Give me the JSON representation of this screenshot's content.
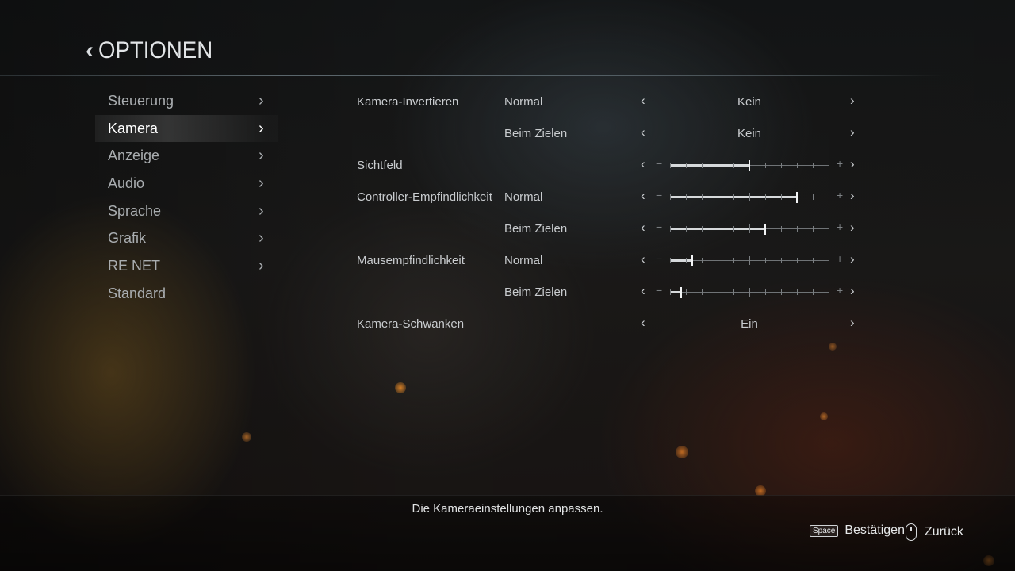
{
  "header": {
    "back_icon": "chevron-left-icon",
    "title": "OPTIONEN"
  },
  "menu": {
    "items": [
      {
        "label": "Steuerung",
        "has_arrow": true,
        "active": false
      },
      {
        "label": "Kamera",
        "has_arrow": true,
        "active": true
      },
      {
        "label": "Anzeige",
        "has_arrow": true,
        "active": false
      },
      {
        "label": "Audio",
        "has_arrow": true,
        "active": false
      },
      {
        "label": "Sprache",
        "has_arrow": true,
        "active": false
      },
      {
        "label": "Grafik",
        "has_arrow": true,
        "active": false
      },
      {
        "label": "RE NET",
        "has_arrow": true,
        "active": false
      },
      {
        "label": "Standard",
        "has_arrow": false,
        "active": false
      }
    ]
  },
  "settings": {
    "rows": [
      {
        "label": "Kamera-Invertieren",
        "sub": "Normal",
        "type": "selector",
        "value": "Kein"
      },
      {
        "label": "",
        "sub": "Beim Zielen",
        "type": "selector",
        "value": "Kein"
      },
      {
        "label": "Sichtfeld",
        "sub": "",
        "type": "slider",
        "level": 0.5
      },
      {
        "label": "Controller-Empfindlichkeit",
        "sub": "Normal",
        "type": "slider",
        "level": 0.8
      },
      {
        "label": "",
        "sub": "Beim Zielen",
        "type": "slider",
        "level": 0.6
      },
      {
        "label": "Mausempfindlichkeit",
        "sub": "Normal",
        "type": "slider",
        "level": 0.14
      },
      {
        "label": "",
        "sub": "Beim Zielen",
        "type": "slider",
        "level": 0.07
      },
      {
        "label": "Kamera-Schwanken",
        "sub": "",
        "type": "selector",
        "value": "Ein"
      }
    ],
    "left_arrow": "‹",
    "right_arrow": "›",
    "minus": "−",
    "plus": "+"
  },
  "footer": {
    "description": "Die Kameraeinstellungen anpassen.",
    "confirm_key": "Space",
    "confirm_label": "Bestätigen",
    "back_icon": "mouse-right-button-icon",
    "back_label": "Zurück"
  },
  "colors": {
    "text_active": "#ffffff",
    "text_inactive": "#a9adb0",
    "slider_fill": "#d6d9db"
  }
}
